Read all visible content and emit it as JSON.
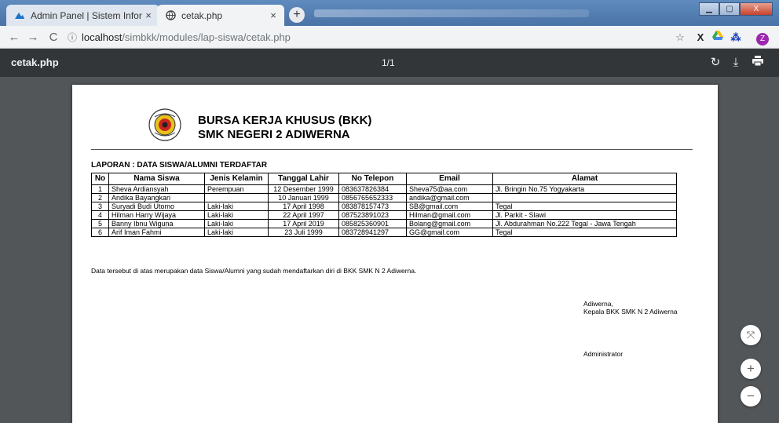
{
  "browser": {
    "tabs": [
      {
        "title": "Admin Panel | Sistem Informasi B",
        "close": "×"
      },
      {
        "title": "cetak.php",
        "close": "×"
      }
    ],
    "new_tab": "+",
    "url_host": "localhost",
    "url_path": "/simbkk/modules/lap-siswa/cetak.php",
    "profile_initial": "Z"
  },
  "pdf_toolbar": {
    "title": "cetak.php",
    "page_indicator": "1/1"
  },
  "report": {
    "heading_line1": "BURSA KERJA KHUSUS (BKK)",
    "heading_line2": "SMK NEGERI 2 ADIWERNA",
    "title": "LAPORAN : DATA SISWA/ALUMNI TERDAFTAR",
    "columns": [
      "No",
      "Nama Siswa",
      "Jenis Kelamin",
      "Tanggal Lahir",
      "No Telepon",
      "Email",
      "Alamat"
    ],
    "rows": [
      [
        "1",
        "Sheva Ardiansyah",
        "Perempuan",
        "12 Desember 1999",
        "083637826384",
        "Sheva75@aa.com",
        "Jl. Bringin No.75 Yogyakarta"
      ],
      [
        "2",
        "Andika Bayangkari",
        "",
        "10 Januari 1999",
        "0856765652333",
        "andika@gmail.com",
        ""
      ],
      [
        "3",
        "Suryadi Budi Utomo",
        "Laki-laki",
        "17 April 1998",
        "083878157473",
        "SB@gmail.com",
        "Tegal"
      ],
      [
        "4",
        "Hilman Harry Wijaya",
        "Laki-laki",
        "22 April 1997",
        "087523891023",
        "Hilman@gmail.com",
        "Jl. Parkit - Slawi"
      ],
      [
        "5",
        "Banny Ibnu Wiguna",
        "Laki-laki",
        "17 April 2019",
        "085825360901",
        "Bolang@gmail.com",
        "Jl. Abdurahman No.222 Tegal - Jawa Tengah"
      ],
      [
        "6",
        "Arif Iman Fahmi",
        "Laki-laki",
        "23 Juli 1999",
        "083728941297",
        "GG@gmail.com",
        "Tegal"
      ]
    ],
    "note": "Data tersebut di atas merupakan data Siswa/Alumni yang sudah mendaftarkan diri di BKK SMK N 2 Adiwerna.",
    "signature_place": "Adiwerna,",
    "signature_role": "Kepala BKK SMK N 2 Adiwerna",
    "signature_name": "Administrator",
    "logo_text": "SMK NEGERI 2 ADIWERNA"
  },
  "icons": {
    "back": "←",
    "forward": "→",
    "reload": "C",
    "info": "ⓘ",
    "star": "☆",
    "rotate": "↻",
    "download": "⤓",
    "print": "🖶",
    "fit": "⤧",
    "zoom_in": "+",
    "zoom_out": "−",
    "minimize": "▁",
    "maximize": "▢",
    "close": "X"
  }
}
